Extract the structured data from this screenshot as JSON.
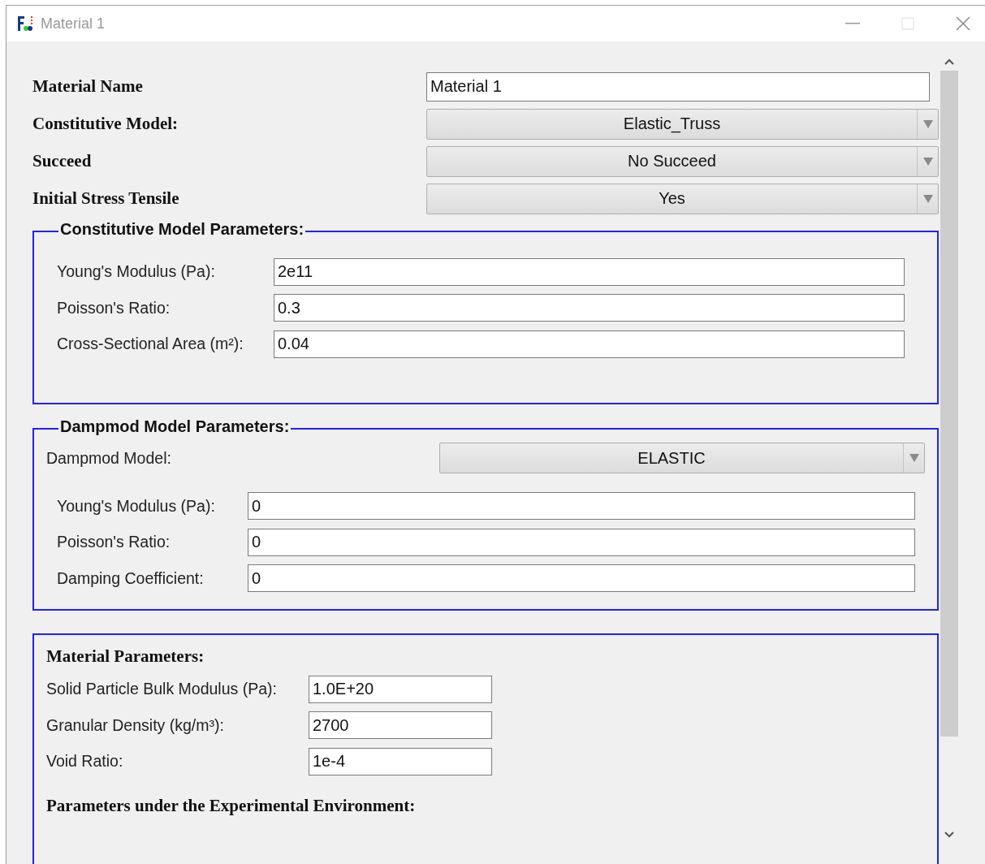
{
  "window": {
    "title": "Material 1"
  },
  "fields": [
    {
      "kind": "text",
      "label": "Material Name",
      "value": "Material 1"
    },
    {
      "kind": "combo",
      "label": "Constitutive Model:",
      "value": "Elastic_Truss"
    },
    {
      "kind": "combo",
      "label": "Succeed",
      "value": "No Succeed"
    },
    {
      "kind": "combo",
      "label": "Initial Stress Tensile",
      "value": "Yes"
    }
  ],
  "constitutive_group": {
    "title": "Constitutive Model Parameters:",
    "rows": [
      {
        "label": "Young's Modulus (Pa):",
        "value": "2e11"
      },
      {
        "label": "Poisson's Ratio:",
        "value": "0.3"
      },
      {
        "label": "Cross-Sectional Area (m²):",
        "value": "0.04"
      }
    ]
  },
  "dampmod_group": {
    "title": "Dampmod Model Parameters:",
    "model_label": "Dampmod Model:",
    "model_value": "ELASTIC",
    "rows": [
      {
        "label": "Young's Modulus (Pa):",
        "value": "0"
      },
      {
        "label": "Poisson's Ratio:",
        "value": "0"
      },
      {
        "label": "Damping Coefficient:",
        "value": "0"
      }
    ]
  },
  "material_group": {
    "heading": "Material Parameters:",
    "rows": [
      {
        "label": "Solid Particle Bulk Modulus (Pa):",
        "value": "1.0E+20"
      },
      {
        "label": "Granular Density (kg/m³):",
        "value": "2700"
      },
      {
        "label": "Void Ratio:",
        "value": "1e-4"
      }
    ],
    "subheading": "Parameters under the Experimental Environment:"
  }
}
